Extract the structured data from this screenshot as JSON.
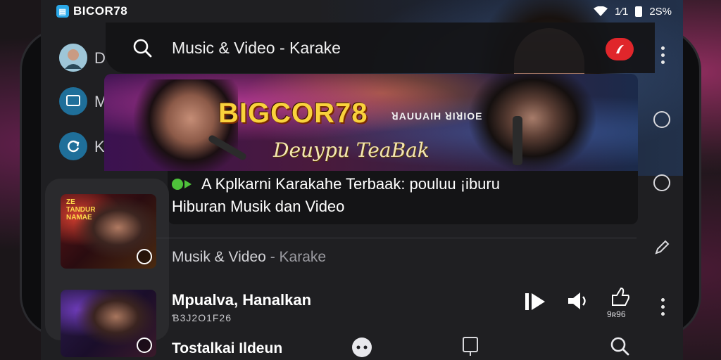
{
  "status_bar": {
    "brand": "BICOR78",
    "indicators": "1⁄1",
    "battery_text": "2S%",
    "icons": [
      "wifi-icon",
      "signal-icon",
      "battery-icon"
    ]
  },
  "side_rail": [
    {
      "icon": "avatar",
      "label": "D"
    },
    {
      "icon": "screen-icon",
      "label": "M"
    },
    {
      "icon": "refresh-icon",
      "label": "K"
    }
  ],
  "search": {
    "title": "Music & Video - Karake"
  },
  "banner": {
    "title": "BIGCOR78",
    "subtitle": "ꓤAUUAIH ꓤIꓤIOE",
    "script": "Deuypu TeaBak"
  },
  "card": {
    "line1": "A Kplkarni Karakahe Terbaak: pouluu ¡iburu",
    "line2": "Hiburan Musik dan Video"
  },
  "section": {
    "label_main": "Musik & Video",
    "label_muted": " - Karake"
  },
  "thumb1": {
    "text": "ZE\nTANDUR\nNAMAE"
  },
  "list_item": {
    "title": "Mpualva, Hanalkan",
    "subtitle": "Ɓ3J2O1F26",
    "count": "9ʀ96"
  },
  "list_item2": {
    "title": "Tostalkai Ildeun"
  },
  "colors": {
    "accent_red": "#e0262b",
    "banner_yellow": "#f9d23c",
    "badge_green": "#4ec23a",
    "brand_blue": "#2aa8e8"
  }
}
